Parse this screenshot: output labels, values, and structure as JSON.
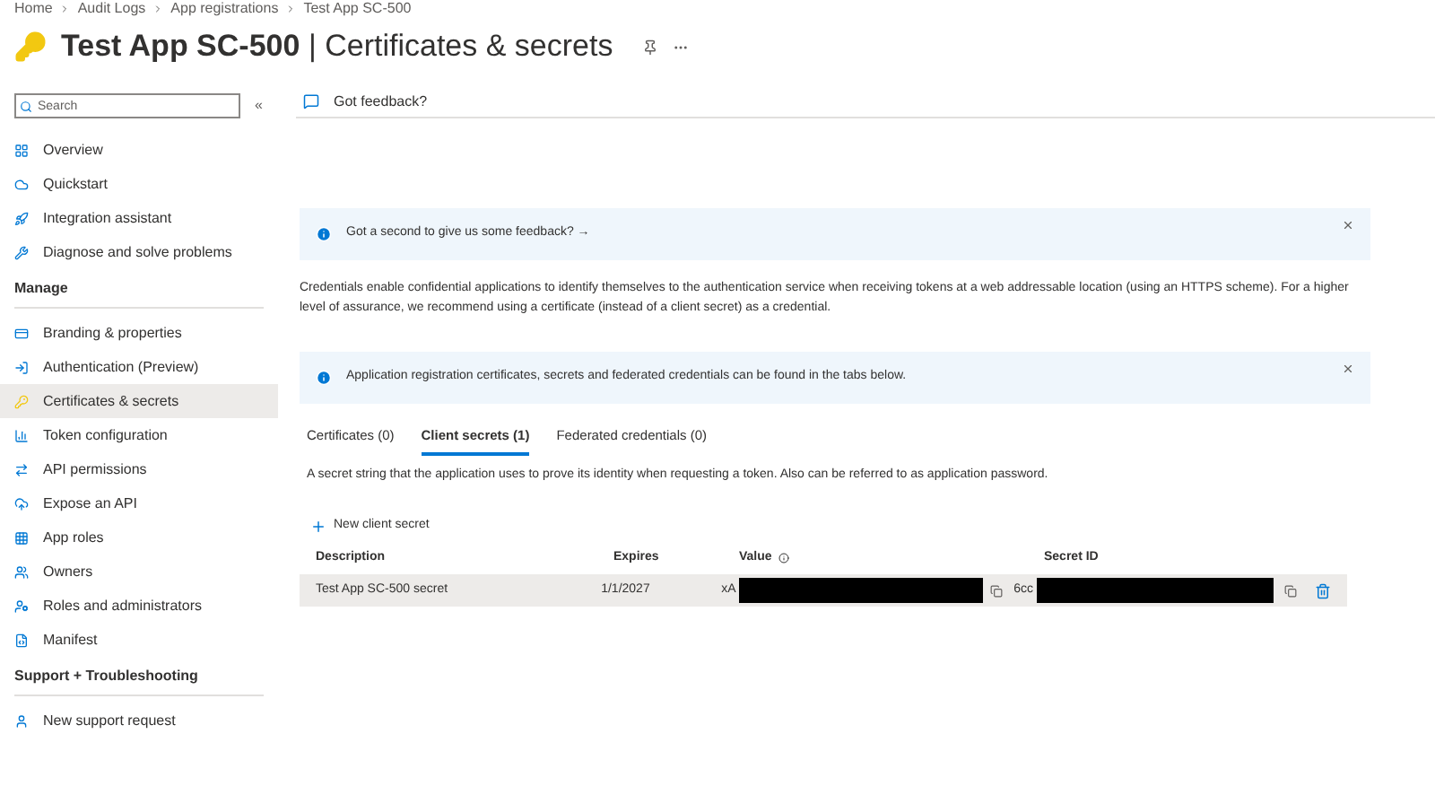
{
  "breadcrumb": [
    "Home",
    "Audit Logs",
    "App registrations",
    "Test App SC-500"
  ],
  "title": {
    "app": "Test App SC-500",
    "separator": "|",
    "page": "Certificates & secrets"
  },
  "sidebar": {
    "search": {
      "placeholder": "Search"
    },
    "collapse": "«",
    "items": [
      {
        "kind": "item",
        "label": "Overview",
        "selected": false
      },
      {
        "kind": "item",
        "label": "Quickstart",
        "selected": false
      },
      {
        "kind": "item",
        "label": "Integration assistant",
        "selected": false
      },
      {
        "kind": "item",
        "label": "Diagnose and solve problems",
        "selected": false
      },
      {
        "kind": "heading",
        "label": "Manage"
      },
      {
        "kind": "item",
        "label": "Branding & properties",
        "selected": false
      },
      {
        "kind": "item",
        "label": "Authentication (Preview)",
        "selected": false
      },
      {
        "kind": "item",
        "label": "Certificates & secrets",
        "selected": true
      },
      {
        "kind": "item",
        "label": "Token configuration",
        "selected": false
      },
      {
        "kind": "item",
        "label": "API permissions",
        "selected": false
      },
      {
        "kind": "item",
        "label": "Expose an API",
        "selected": false
      },
      {
        "kind": "item",
        "label": "App roles",
        "selected": false
      },
      {
        "kind": "item",
        "label": "Owners",
        "selected": false
      },
      {
        "kind": "item",
        "label": "Roles and administrators",
        "selected": false
      },
      {
        "kind": "item",
        "label": "Manifest",
        "selected": false
      },
      {
        "kind": "heading",
        "label": "Support + Troubleshooting"
      },
      {
        "kind": "item",
        "label": "New support request",
        "selected": false
      }
    ]
  },
  "toolbar": {
    "feedback": "Got feedback?"
  },
  "banners": [
    {
      "text": "Got a second to give us some feedback? →"
    }
  ],
  "description": "Credentials enable confidential applications to identify themselves to the authentication service when receiving tokens at a web addressable location (using an HTTPS scheme). For a higher level of assurance, we recommend using a certificate (instead of a client secret) as a credential.",
  "info_banner": {
    "text": "Application registration certificates, secrets and federated credentials can be found in the tabs below."
  },
  "tabs": [
    {
      "label": "Certificates (0)",
      "selected": false
    },
    {
      "label": "Client secrets (1)",
      "selected": true
    },
    {
      "label": "Federated credentials (0)",
      "selected": false
    }
  ],
  "tab_description": "A secret string that the application uses to prove its identity when requesting a token. Also can be referred to as application password.",
  "new_button": "New client secret",
  "table": {
    "columns": [
      "Description",
      "Expires",
      "Value",
      "Secret ID"
    ],
    "rows": [
      {
        "description": "Test App SC-500 secret",
        "expires": "1/1/2027",
        "value": "xA",
        "secret_id": "6cc"
      }
    ]
  }
}
